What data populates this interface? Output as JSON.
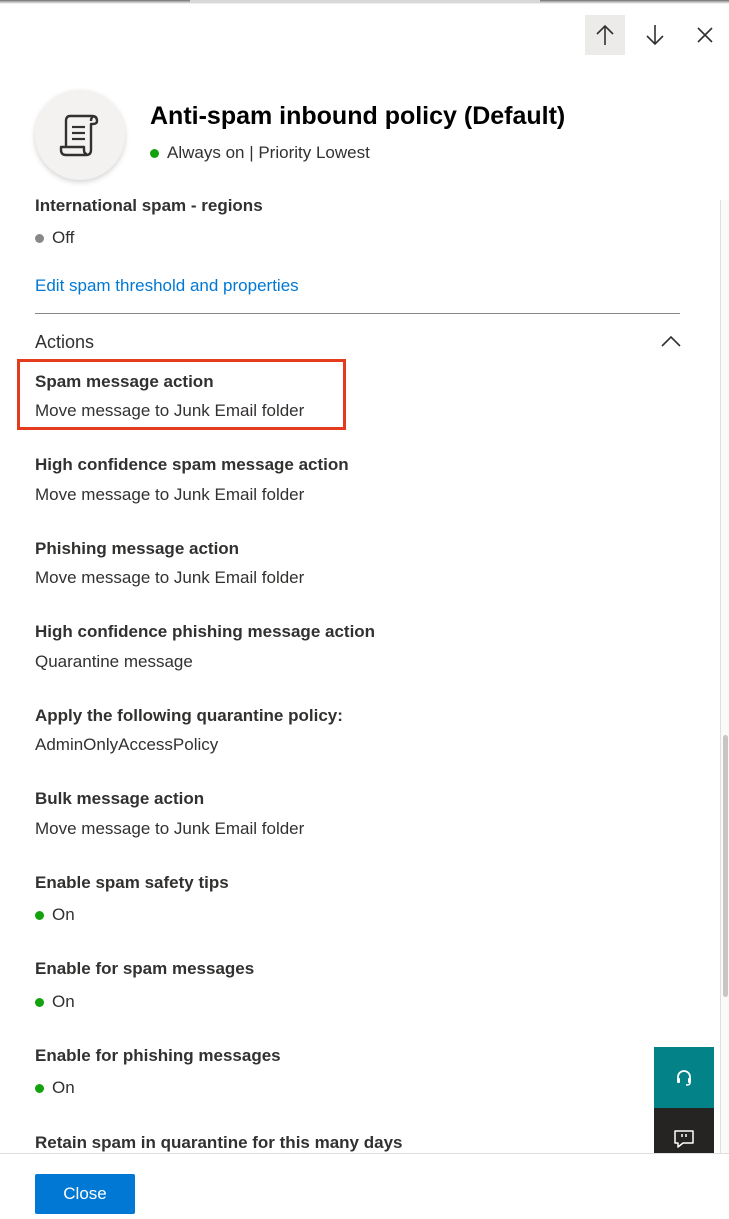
{
  "header": {
    "title": "Anti-spam inbound policy (Default)",
    "status_text": "Always on | Priority Lowest",
    "status_color": "#13a10e",
    "avatar_icon": "policy-scroll-icon"
  },
  "nav": {
    "prev_icon": "arrow-up-icon",
    "next_icon": "arrow-down-icon",
    "close_icon": "close-icon"
  },
  "properties": {
    "intl_regions": {
      "label": "International spam - regions",
      "value": "Off",
      "status_color": "#8a8886"
    },
    "edit_link": "Edit spam threshold and properties"
  },
  "actions": {
    "header": "Actions",
    "items": [
      {
        "label": "Spam message action",
        "value": "Move message to Junk Email folder"
      },
      {
        "label": "High confidence spam message action",
        "value": "Move message to Junk Email folder"
      },
      {
        "label": "Phishing message action",
        "value": "Move message to Junk Email folder"
      },
      {
        "label": "High confidence phishing message action",
        "value": "Quarantine message"
      },
      {
        "label": "Apply the following quarantine policy:",
        "value": "AdminOnlyAccessPolicy"
      },
      {
        "label": "Bulk message action",
        "value": "Move message to Junk Email folder"
      },
      {
        "label": "Enable spam safety tips",
        "value": "On"
      },
      {
        "label": "Enable for spam messages",
        "value": "On"
      },
      {
        "label": "Enable for phishing messages",
        "value": "On"
      },
      {
        "label": "Retain spam in quarantine for this many days"
      }
    ]
  },
  "footer": {
    "close_label": "Close"
  },
  "floating": {
    "help_icon": "headset-icon",
    "feedback_icon": "feedback-icon"
  },
  "colors": {
    "accent": "#0078d4",
    "highlight": "#e43b1f",
    "help_bg": "#038387",
    "feedback_bg": "#252423"
  }
}
